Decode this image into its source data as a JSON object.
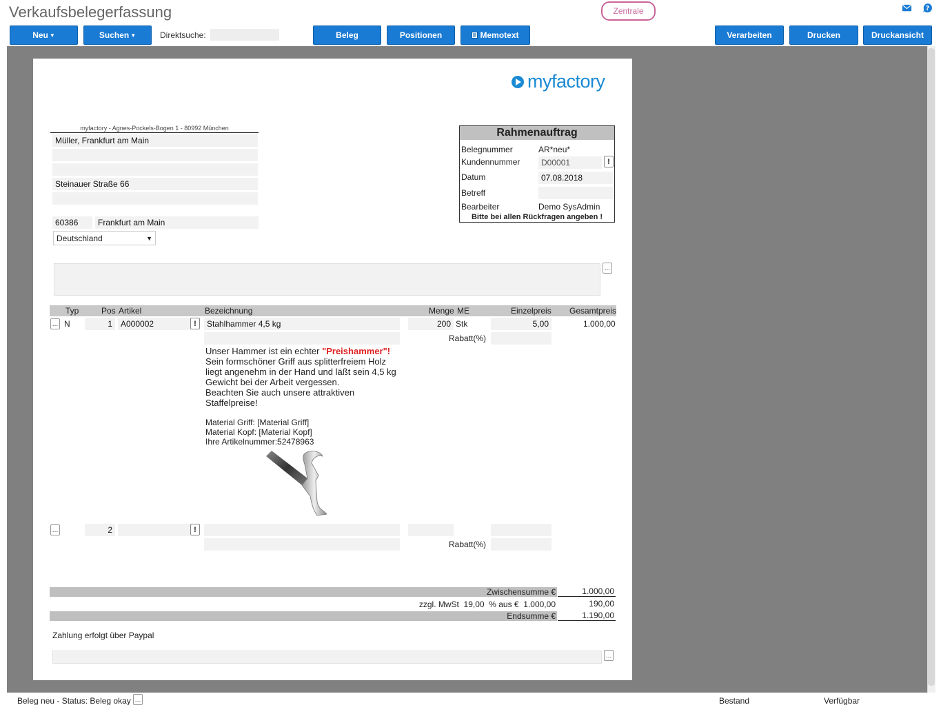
{
  "header": {
    "title": "Verkaufsbelegerfassung",
    "zentrale_label": "Zentrale"
  },
  "toolbar": {
    "neu_label": "Neu",
    "suchen_label": "Suchen",
    "direktsuche_label": "Direktsuche:",
    "direktsuche_value": "",
    "beleg_label": "Beleg",
    "positionen_label": "Positionen",
    "memotext_label": "Memotext",
    "verarbeiten_label": "Verarbeiten",
    "drucken_label": "Drucken",
    "druckansicht_label": "Druckansicht"
  },
  "document": {
    "logo_prefix": "my",
    "logo_suffix": "factory",
    "sender_line": "myfactory - Agnes-Pockels-Bogen 1 - 80992 München",
    "address": {
      "line1": "Müller, Frankfurt am Main",
      "line2": "",
      "line3": "",
      "street": "Steinauer Straße 66",
      "line5": "",
      "zip": "60386",
      "city": "Frankfurt am Main",
      "country": "Deutschland"
    },
    "infobox": {
      "title": "Rahmenauftrag",
      "belegnummer_label": "Belegnummer",
      "belegnummer_value": "AR*neu*",
      "kundennummer_label": "Kundennummer",
      "kundennummer_value": "D00001",
      "datum_label": "Datum",
      "datum_value": "07.08.2018",
      "betreff_label": "Betreff",
      "betreff_value": "",
      "bearbeiter_label": "Bearbeiter",
      "bearbeiter_value": "Demo SysAdmin",
      "notice": "Bitte bei allen Rückfragen angeben !"
    },
    "table_headers": {
      "typ": "Typ",
      "pos": "Pos",
      "artikel": "Artikel",
      "bezeichnung": "Bezeichnung",
      "menge": "Menge",
      "me": "ME",
      "einzelpreis": "Einzelpreis",
      "gesamtpreis": "Gesamtpreis"
    },
    "positions": [
      {
        "typ": "N",
        "pos": "1",
        "artikel": "A000002",
        "bezeichnung": "Stahlhammer 4,5 kg",
        "bezeichnung2": "",
        "menge": "200",
        "me": "Stk",
        "einzelpreis": "5,00",
        "rabatt_label": "Rabatt(%)",
        "rabatt": "",
        "gesamtpreis": "1.000,00",
        "text_intro": "Unser Hammer ist ein echter ",
        "text_highlight": "\"Preishammer\"!",
        "text_lines": [
          "Sein formschöner Griff aus splitterfreiem Holz",
          "liegt angenehm in der Hand und läßt sein 4,5 kg",
          "Gewicht bei der Arbeit vergessen.",
          "Beachten Sie auch unsere attraktiven",
          "Staffelpreise!"
        ],
        "attr_lines": [
          "Material Griff: [Material Griff]",
          "Material Kopf: [Material Kopf]",
          "Ihre Artikelnummer:52478963"
        ]
      },
      {
        "typ": "",
        "pos": "2",
        "artikel": "",
        "bezeichnung": "",
        "bezeichnung2": "",
        "menge": "",
        "einzelpreis": "",
        "rabatt_label": "Rabatt(%)",
        "rabatt": ""
      }
    ],
    "totals": {
      "zwischensumme_label": "Zwischensumme €",
      "zwischensumme_value": "1.000,00",
      "mwst_label": "zzgl. MwSt  19,00  % aus €  1.000,00",
      "mwst_value": "190,00",
      "endsumme_label": "Endsumme €",
      "endsumme_value": "1.190,00"
    },
    "zahlung": "Zahlung erfolgt über Paypal"
  },
  "statusbar": {
    "status_text": "Beleg neu - Status: Beleg okay",
    "bestand_label": "Bestand",
    "verfuegbar_label": "Verfügbar"
  },
  "colors": {
    "accent": "#1a7bd4",
    "zentrale": "#c8659a",
    "highlight_red": "#e02020"
  }
}
